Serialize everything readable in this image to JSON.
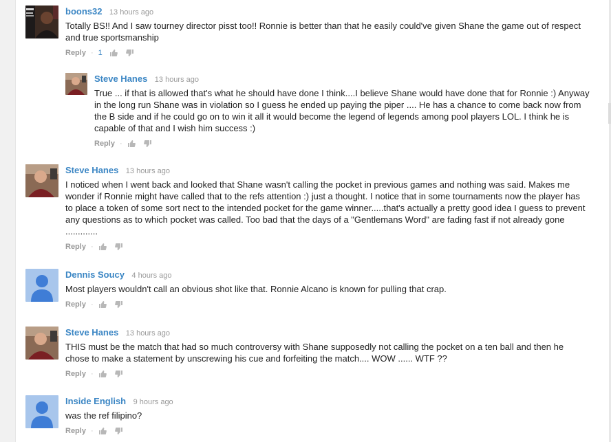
{
  "colors": {
    "author_link": "#3b86c4",
    "meta_gray": "#999999",
    "text": "#222222"
  },
  "comments": [
    {
      "author": "boons32",
      "time": "13 hours ago",
      "text": "Totally BS!! And I saw tourney director pisst too!! Ronnie is better than that he easily could've given Shane the game out of respect and true sportsmanship",
      "reply_label": "Reply",
      "like_count": "1",
      "avatar_icon": "profile-photo"
    },
    {
      "author": "Steve Hanes",
      "time": "13 hours ago",
      "text": "True ... if that is allowed that's what he should have done I think....I believe Shane would have done that for Ronnie :)  Anyway in the long run Shane was in violation so I guess he ended up paying the piper ....  He has a chance to come back now from the B side and if he could go on to win it all it would become the legend of legends among pool players LOL.  I think he is capable of that and I wish him success :)",
      "reply_label": "Reply",
      "avatar_icon": "profile-photo"
    },
    {
      "author": "Steve Hanes",
      "time": "13 hours ago",
      "text": "I noticed when I went back and looked that Shane wasn't calling the pocket in previous games and nothing was said.  Makes me wonder if Ronnie might have called that to the refs attention :)  just a thought.  I notice that in some tournaments now the player has to place a token of some sort nect to the intended pocket for the game winner.....that's actually a pretty good idea I guess to prevent any questions as to which pocket was called.  Too bad that the days of a \"Gentlemans Word\" are fading fast if not already gone .............",
      "reply_label": "Reply",
      "avatar_icon": "profile-photo"
    },
    {
      "author": "Dennis Soucy",
      "time": "4 hours ago",
      "text": "Most players wouldn't call an obvious shot like that. Ronnie Alcano is known for pulling that crap.",
      "reply_label": "Reply",
      "avatar_icon": "default-user-icon"
    },
    {
      "author": "Steve Hanes",
      "time": "13 hours ago",
      "text": "THIS must be the match that had so much controversy with Shane supposedly not calling the pocket on a ten ball and then he chose to make a statement by unscrewing his cue and forfeiting the match.... WOW ...... WTF ??",
      "reply_label": "Reply",
      "avatar_icon": "profile-photo"
    },
    {
      "author": "Inside English",
      "time": "9 hours ago",
      "text": "was the ref filipino?",
      "reply_label": "Reply",
      "avatar_icon": "default-user-icon"
    }
  ]
}
